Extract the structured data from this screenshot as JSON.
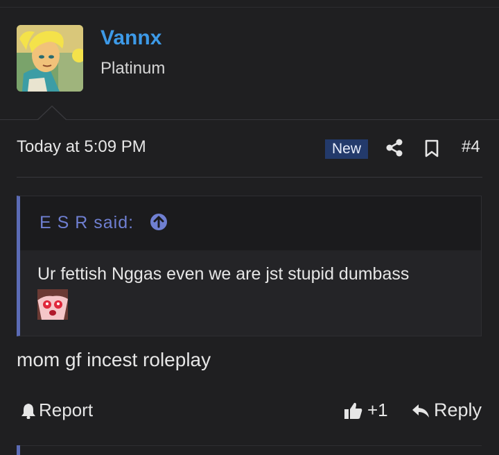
{
  "user": {
    "name": "Vannx",
    "title": "Platinum",
    "avatar_icon": "cartoon-avatar-icon"
  },
  "post": {
    "date": "Today at 5:09 PM",
    "badge": "New",
    "number": "#4",
    "share_icon": "share-icon",
    "bookmark_icon": "bookmark-icon",
    "text": "mom gf incest roleplay"
  },
  "quote": {
    "author": "E S R said:",
    "text": "Ur fettish Nggas even we are jst stupid dumbass",
    "emoji_icon": "anime-face-emoji"
  },
  "actions": {
    "report": "Report",
    "like_count": "+1",
    "reply": "Reply"
  },
  "colors": {
    "background": "#1f1f21",
    "username": "#3d9ae8",
    "accent_quote": "#5b6bb5",
    "badge": "#233a6b"
  }
}
